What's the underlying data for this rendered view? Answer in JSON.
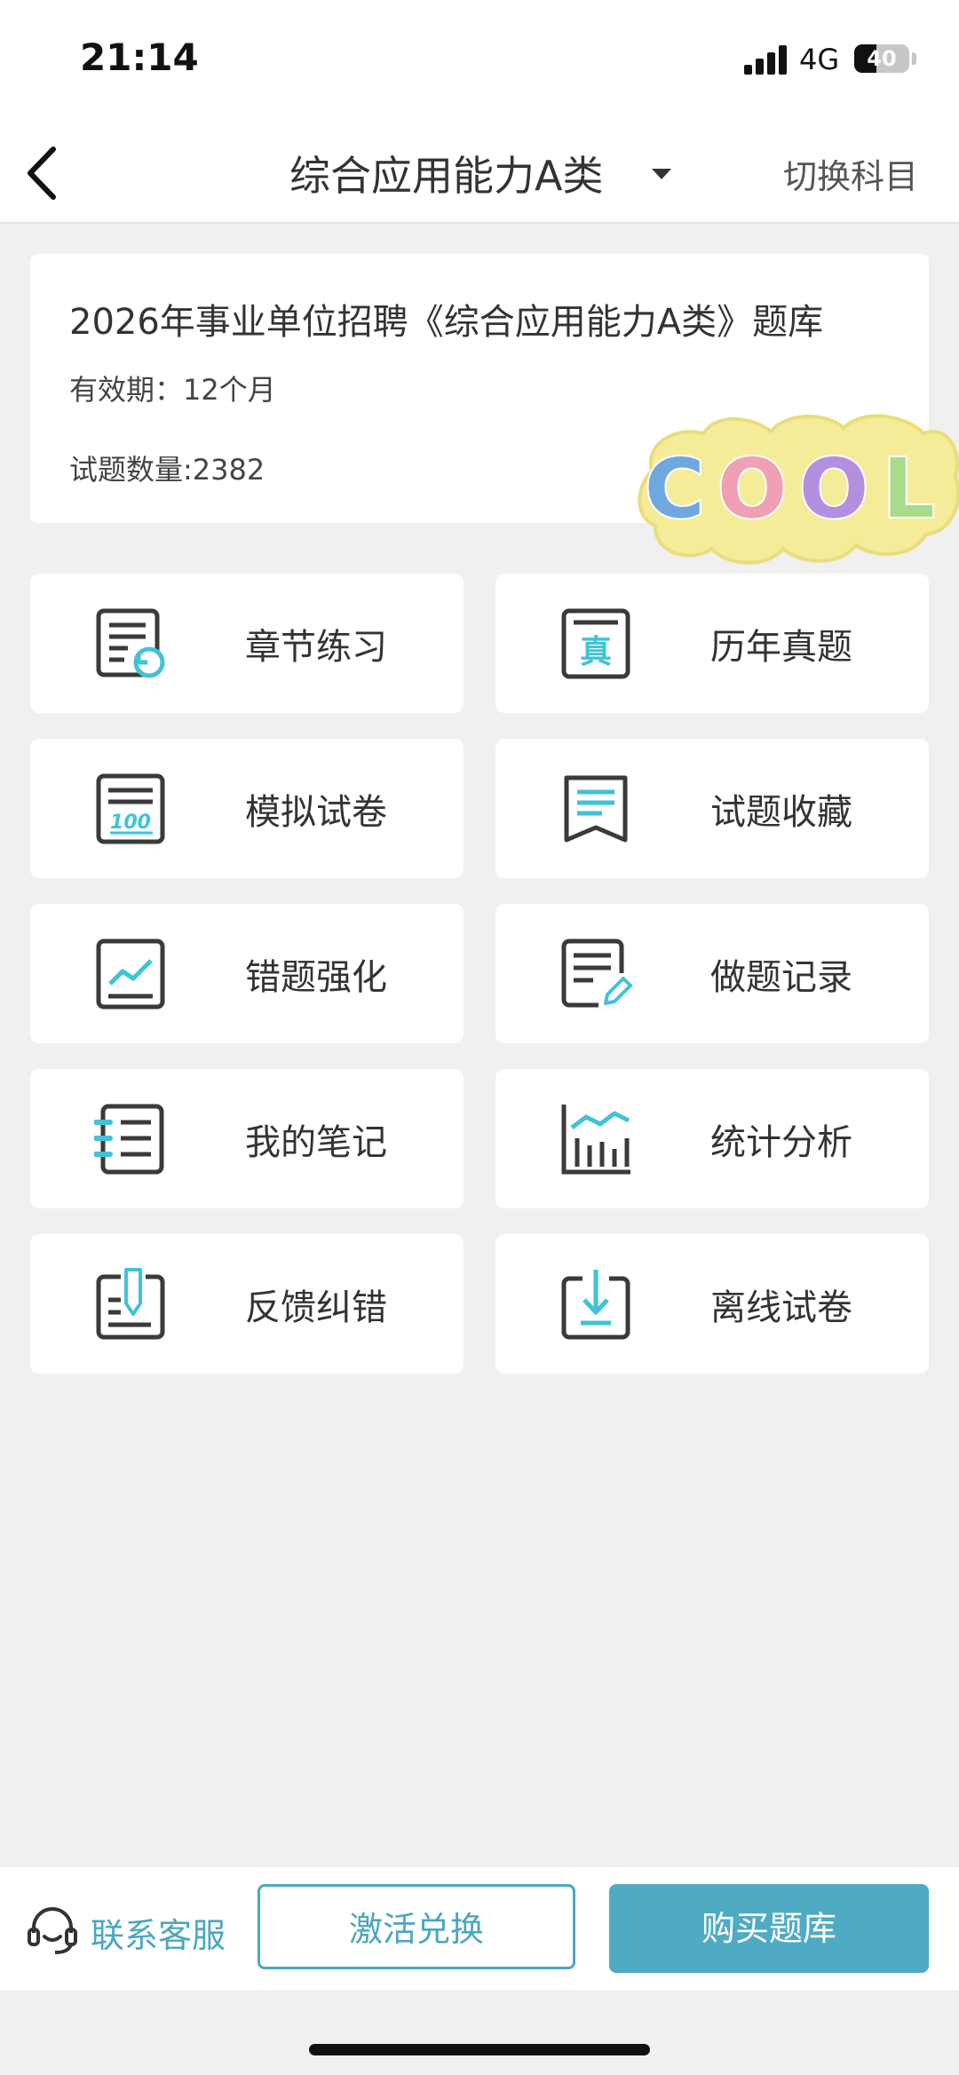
{
  "status_bar": {
    "time": "21:14",
    "network": "4G",
    "battery": "40",
    "battery_level": 0.4
  },
  "header": {
    "title": "综合应用能力A类",
    "switch_label": "切换科目"
  },
  "info": {
    "title": "2026年事业单位招聘《综合应用能力A类》题库",
    "validity": "有效期：12个月",
    "question_count": "试题数量:2382",
    "sticker_text": "COOL"
  },
  "menu": [
    {
      "label": "章节练习",
      "icon": "chapter-practice-icon"
    },
    {
      "label": "历年真题",
      "icon": "past-exams-icon"
    },
    {
      "label": "模拟试卷",
      "icon": "mock-exam-icon"
    },
    {
      "label": "试题收藏",
      "icon": "favorites-icon"
    },
    {
      "label": "错题强化",
      "icon": "wrong-answers-icon"
    },
    {
      "label": "做题记录",
      "icon": "practice-record-icon"
    },
    {
      "label": "我的笔记",
      "icon": "notes-icon"
    },
    {
      "label": "统计分析",
      "icon": "statistics-icon"
    },
    {
      "label": "反馈纠错",
      "icon": "feedback-icon"
    },
    {
      "label": "离线试卷",
      "icon": "offline-download-icon"
    }
  ],
  "footer": {
    "service_label": "联系客服",
    "activate_label": "激活兑换",
    "buy_label": "购买题库"
  },
  "colors": {
    "accent": "#4aa7bf",
    "icon_accent": "#3fc3d6",
    "icon_dark": "#3a3a3a",
    "background": "#f0f0f0"
  }
}
